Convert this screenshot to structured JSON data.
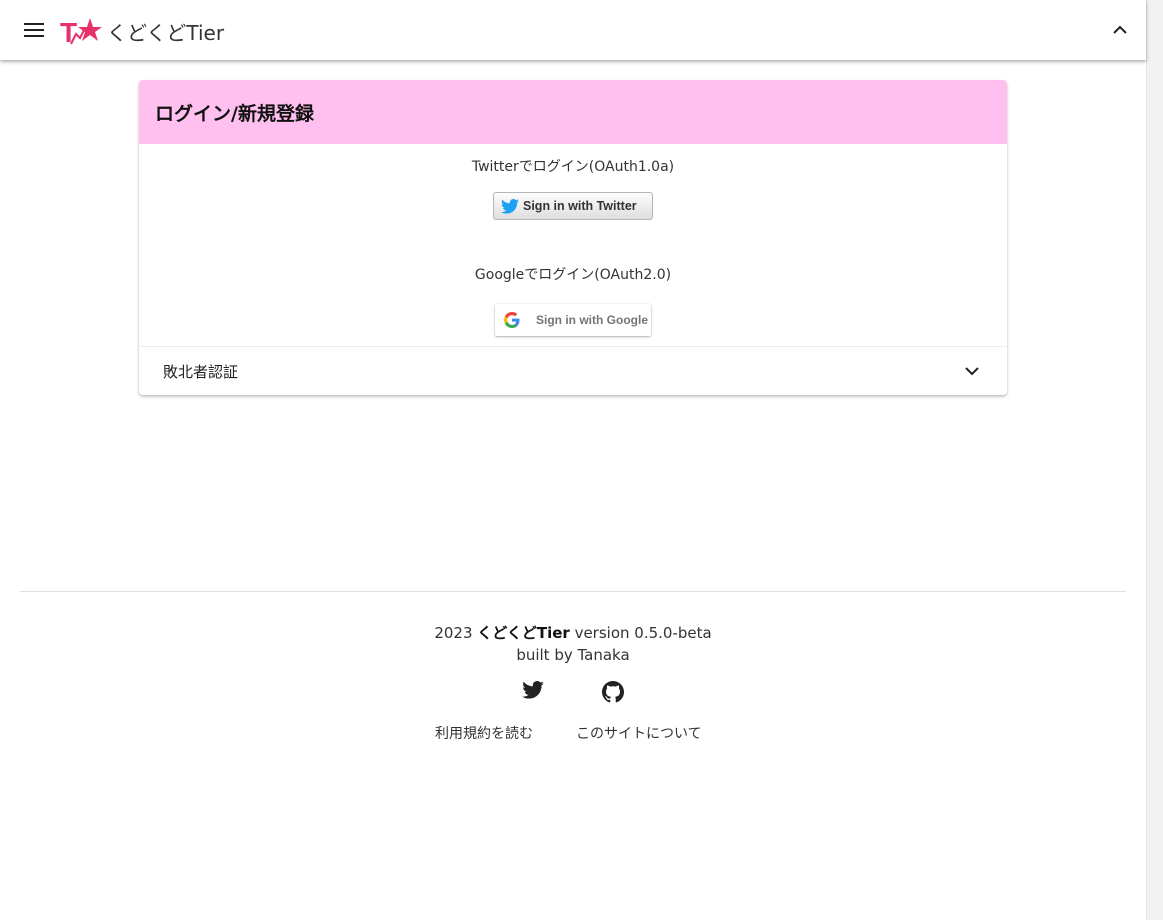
{
  "app": {
    "title": "くどくどTier",
    "logo_text": "T★"
  },
  "login_card": {
    "title": "ログイン/新規登録",
    "twitter_label": "TwitterでログインOAuth1.0a",
    "twitter_label_display": "Twitterでログイン(OAuth1.0a)",
    "twitter_button": "Sign in with Twitter",
    "google_label_display": "Googleでログイン(OAuth2.0)",
    "google_button": "Sign in with Google",
    "expansion_label": "敗北者認証"
  },
  "footer": {
    "year": "2023",
    "brand": "くどくどTier",
    "version": "version 0.5.0-beta",
    "built_by": "built by Tanaka",
    "terms_link": "利用規約を読む",
    "about_link": "このサイトについて"
  },
  "colors": {
    "card_header_bg": "#ffc0f0",
    "logo_pink": "#e8306a",
    "twitter_blue": "#1da1f2"
  },
  "icons": [
    "menu-icon",
    "chevron-up-icon",
    "twitter-bird-icon",
    "google-g-icon",
    "chevron-down-icon",
    "github-icon"
  ]
}
